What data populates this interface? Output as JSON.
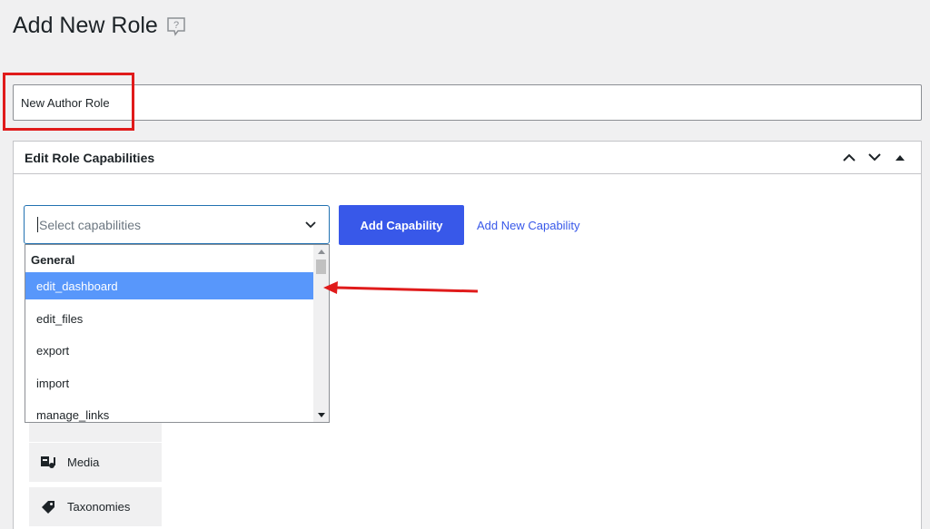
{
  "page": {
    "title": "Add New Role",
    "help_icon": "help-speech-bubble-icon"
  },
  "role_name": {
    "value": "New Author Role"
  },
  "postbox": {
    "title": "Edit Role Capabilities",
    "controls": [
      "chevron-up-icon",
      "chevron-down-icon",
      "triangle-up-icon"
    ]
  },
  "capabilities": {
    "placeholder": "Select capabilities",
    "add_button": "Add Capability",
    "add_link": "Add New Capability"
  },
  "dropdown": {
    "group": "General",
    "options": [
      {
        "label": "edit_dashboard",
        "active": true
      },
      {
        "label": "edit_files",
        "active": false
      },
      {
        "label": "export",
        "active": false
      },
      {
        "label": "import",
        "active": false
      },
      {
        "label": "manage_links",
        "active": false
      }
    ]
  },
  "sidebar": {
    "items": [
      {
        "label": "Media",
        "icon": "media-icon"
      },
      {
        "label": "Taxonomies",
        "icon": "tag-icon"
      }
    ]
  },
  "colors": {
    "accent": "#3858e9",
    "highlight": "#5897fb",
    "annotation_red": "#e01b1b"
  }
}
